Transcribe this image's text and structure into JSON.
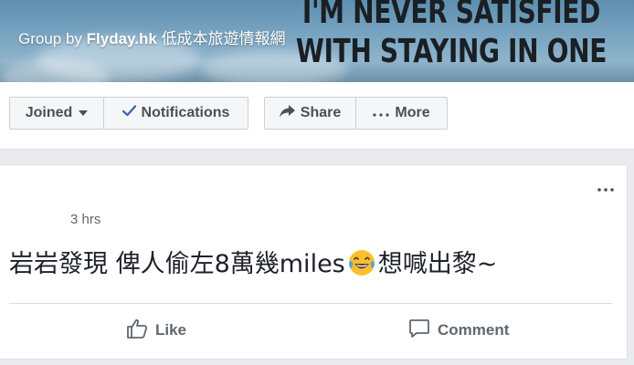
{
  "cover": {
    "caption_prefix": "Group by",
    "group_name": "Flyday.hk",
    "group_tagline": "低成本旅遊情報網",
    "slogan_line1": "I'M NEVER SATISFIED",
    "slogan_line2": "WITH STAYING IN ONE"
  },
  "actions": {
    "joined_label": "Joined",
    "notifications_label": "Notifications",
    "share_label": "Share",
    "more_label": "More"
  },
  "post": {
    "timestamp": "3 hrs",
    "text_before": "岩岩發現 俾人偷左8萬幾miles",
    "emoji": "laughing-tears-emoji",
    "text_after": "想喊出黎~",
    "like_label": "Like",
    "comment_label": "Comment"
  },
  "colors": {
    "accent": "#4267b2",
    "button_bg": "#f5f6f7",
    "page_bg": "#e9ebee"
  }
}
